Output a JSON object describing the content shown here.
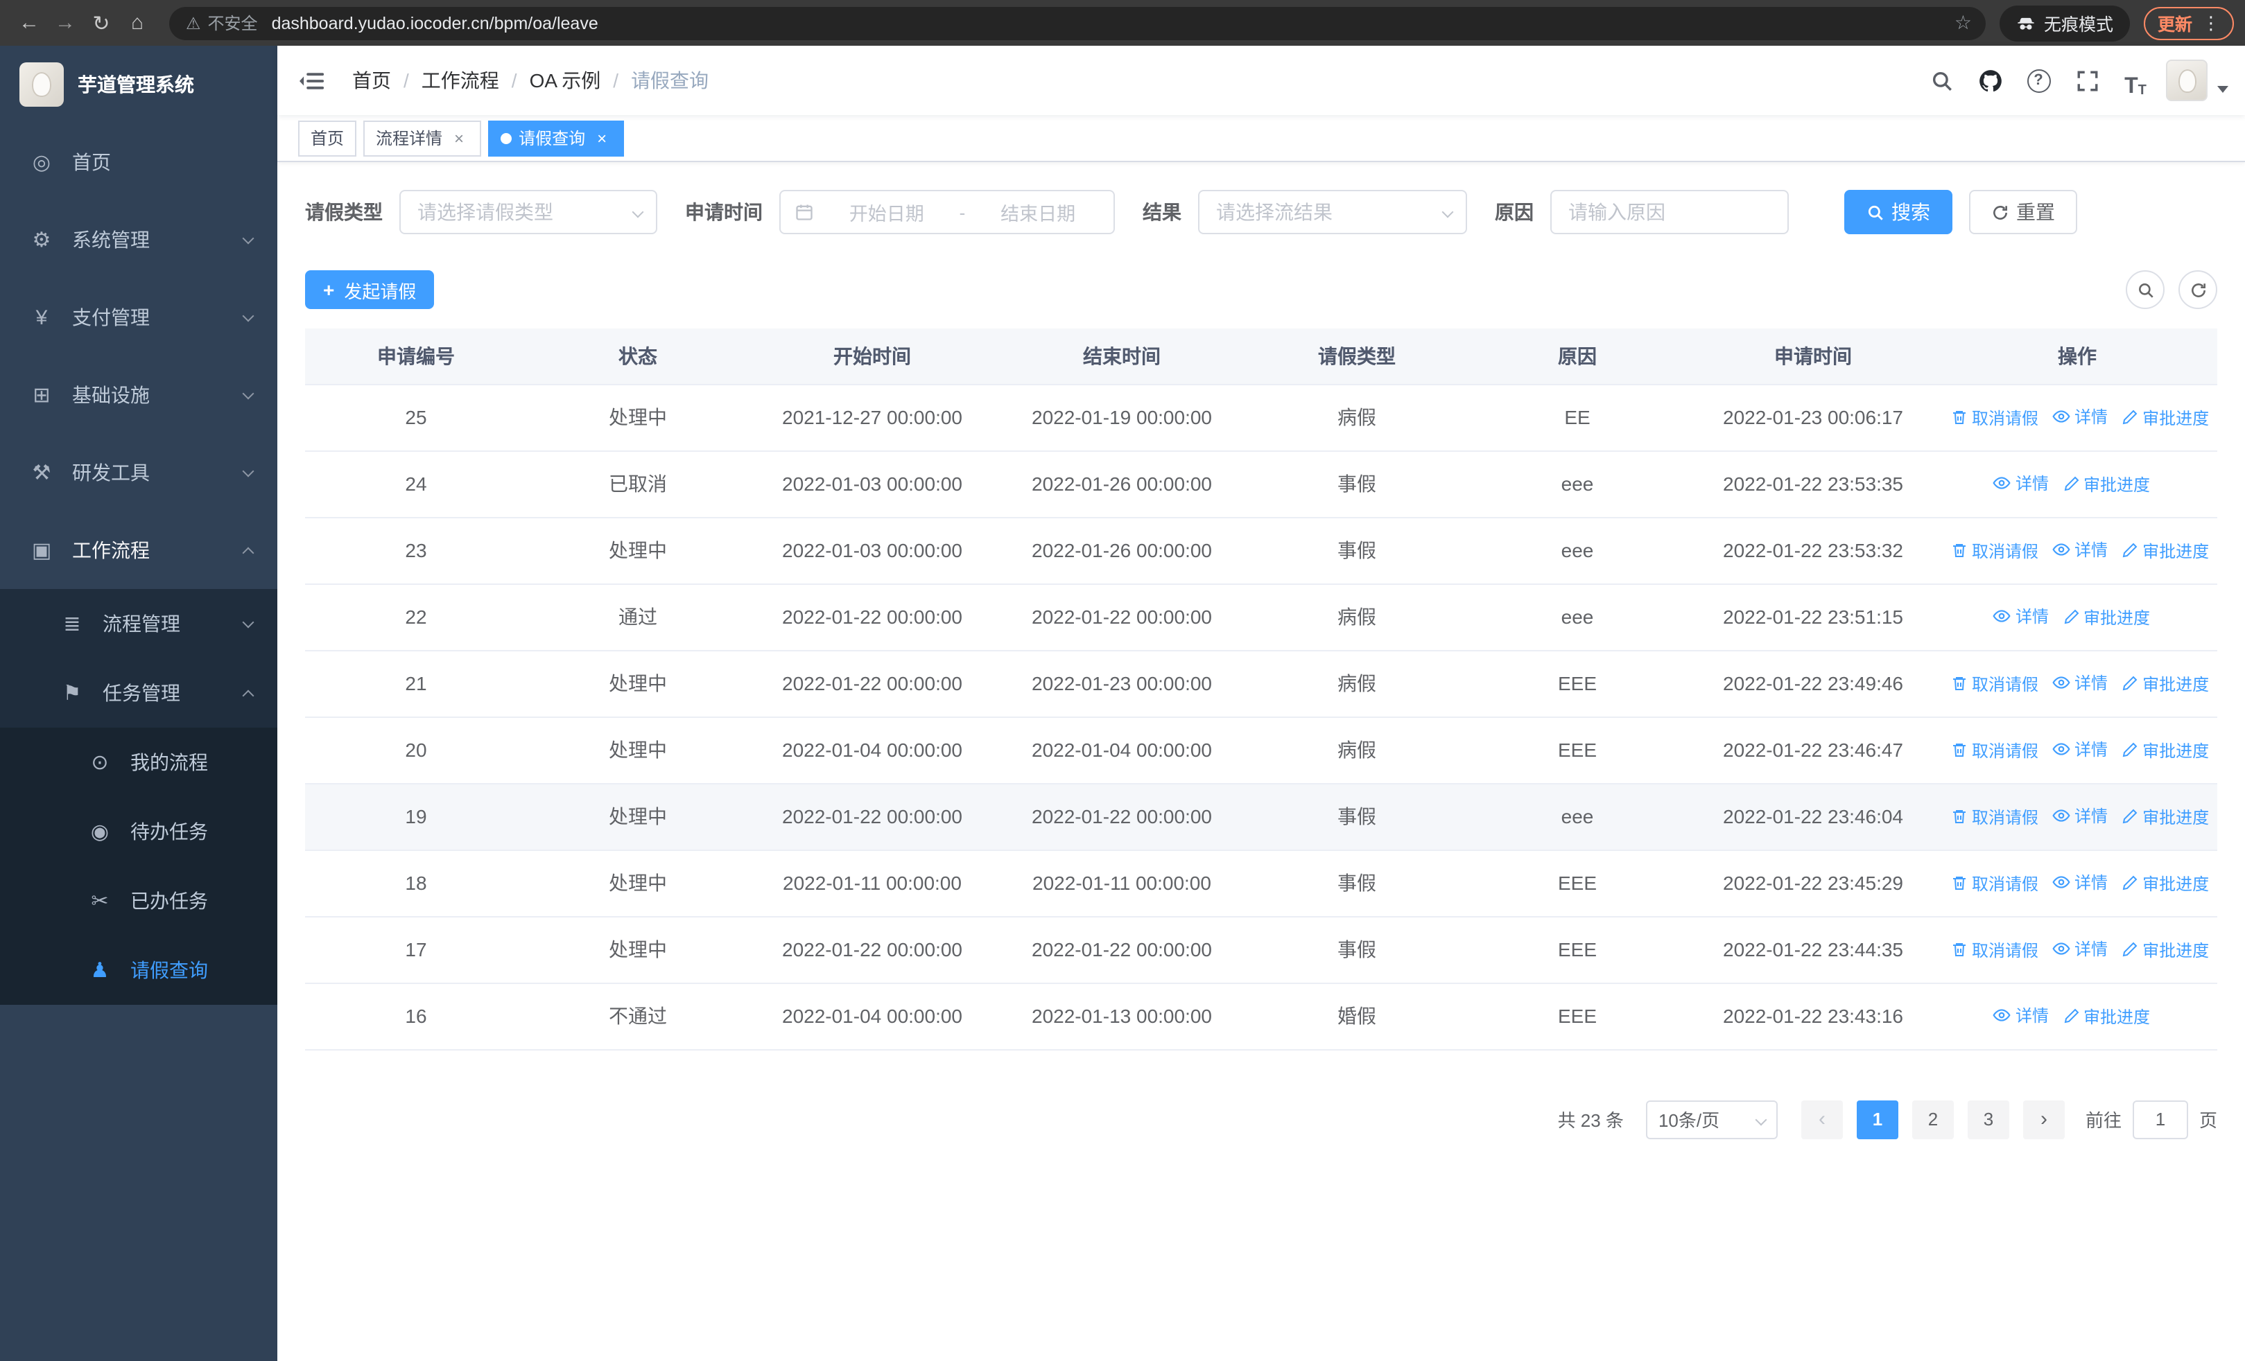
{
  "browser": {
    "security_label": "不安全",
    "url": "dashboard.yudao.iocoder.cn/bpm/oa/leave",
    "incognito_label": "无痕模式",
    "update_label": "更新"
  },
  "icons": {
    "back": "←",
    "forward": "→",
    "reload": "↻",
    "home": "⌂",
    "warning": "⚠",
    "star": "☆",
    "kebab": "⋮",
    "plus": "+",
    "question": "?",
    "tsize_big": "T",
    "tsize_small": "T"
  },
  "sidebar": {
    "logo_title": "芋道管理系统",
    "items": [
      {
        "label": "首页",
        "icon": "◎"
      },
      {
        "label": "系统管理",
        "icon": "⚙"
      },
      {
        "label": "支付管理",
        "icon": "¥"
      },
      {
        "label": "基础设施",
        "icon": "⊞"
      },
      {
        "label": "研发工具",
        "icon": "⚒"
      },
      {
        "label": "工作流程",
        "icon": "▣"
      }
    ],
    "sub_items": [
      {
        "label": "流程管理",
        "icon": "≣"
      },
      {
        "label": "任务管理",
        "icon": "⚑"
      }
    ],
    "leaf_items": [
      {
        "label": "我的流程",
        "icon": "⊙"
      },
      {
        "label": "待办任务",
        "icon": "◉"
      },
      {
        "label": "已办任务",
        "icon": "✂"
      },
      {
        "label": "请假查询",
        "icon": "♟"
      }
    ]
  },
  "header": {
    "breadcrumb": [
      "首页",
      "工作流程",
      "OA 示例",
      "请假查询"
    ],
    "separator": "/"
  },
  "tabs": {
    "close_glyph": "×",
    "items": [
      {
        "label": "首页"
      },
      {
        "label": "流程详情"
      },
      {
        "label": "请假查询"
      }
    ]
  },
  "filters": {
    "leave_type_label": "请假类型",
    "leave_type_placeholder": "请选择请假类型",
    "apply_time_label": "申请时间",
    "start_date_placeholder": "开始日期",
    "range_separator": "-",
    "end_date_placeholder": "结束日期",
    "result_label": "结果",
    "result_placeholder": "请选择流结果",
    "reason_label": "原因",
    "reason_placeholder": "请输入原因",
    "search_label": "搜索",
    "reset_label": "重置"
  },
  "toolbar": {
    "create_label": "发起请假"
  },
  "table": {
    "columns": [
      "申请编号",
      "状态",
      "开始时间",
      "结束时间",
      "请假类型",
      "原因",
      "申请时间",
      "操作"
    ],
    "column_keys": [
      "id",
      "status",
      "start",
      "end",
      "type",
      "reason",
      "applied"
    ],
    "action_labels": {
      "cancel": "取消请假",
      "detail": "详情",
      "progress": "审批进度"
    },
    "rows": [
      {
        "id": "25",
        "status": "处理中",
        "start": "2021-12-27 00:00:00",
        "end": "2022-01-19 00:00:00",
        "type": "病假",
        "reason": "EE",
        "applied": "2022-01-23 00:06:17",
        "cancelable": true,
        "highlighted": false
      },
      {
        "id": "24",
        "status": "已取消",
        "start": "2022-01-03 00:00:00",
        "end": "2022-01-26 00:00:00",
        "type": "事假",
        "reason": "eee",
        "applied": "2022-01-22 23:53:35",
        "cancelable": false,
        "highlighted": false
      },
      {
        "id": "23",
        "status": "处理中",
        "start": "2022-01-03 00:00:00",
        "end": "2022-01-26 00:00:00",
        "type": "事假",
        "reason": "eee",
        "applied": "2022-01-22 23:53:32",
        "cancelable": true,
        "highlighted": false
      },
      {
        "id": "22",
        "status": "通过",
        "start": "2022-01-22 00:00:00",
        "end": "2022-01-22 00:00:00",
        "type": "病假",
        "reason": "eee",
        "applied": "2022-01-22 23:51:15",
        "cancelable": false,
        "highlighted": false
      },
      {
        "id": "21",
        "status": "处理中",
        "start": "2022-01-22 00:00:00",
        "end": "2022-01-23 00:00:00",
        "type": "病假",
        "reason": "EEE",
        "applied": "2022-01-22 23:49:46",
        "cancelable": true,
        "highlighted": false
      },
      {
        "id": "20",
        "status": "处理中",
        "start": "2022-01-04 00:00:00",
        "end": "2022-01-04 00:00:00",
        "type": "病假",
        "reason": "EEE",
        "applied": "2022-01-22 23:46:47",
        "cancelable": true,
        "highlighted": false
      },
      {
        "id": "19",
        "status": "处理中",
        "start": "2022-01-22 00:00:00",
        "end": "2022-01-22 00:00:00",
        "type": "事假",
        "reason": "eee",
        "applied": "2022-01-22 23:46:04",
        "cancelable": true,
        "highlighted": true
      },
      {
        "id": "18",
        "status": "处理中",
        "start": "2022-01-11 00:00:00",
        "end": "2022-01-11 00:00:00",
        "type": "事假",
        "reason": "EEE",
        "applied": "2022-01-22 23:45:29",
        "cancelable": true,
        "highlighted": false
      },
      {
        "id": "17",
        "status": "处理中",
        "start": "2022-01-22 00:00:00",
        "end": "2022-01-22 00:00:00",
        "type": "事假",
        "reason": "EEE",
        "applied": "2022-01-22 23:44:35",
        "cancelable": true,
        "highlighted": false
      },
      {
        "id": "16",
        "status": "不通过",
        "start": "2022-01-04 00:00:00",
        "end": "2022-01-13 00:00:00",
        "type": "婚假",
        "reason": "EEE",
        "applied": "2022-01-22 23:43:16",
        "cancelable": false,
        "highlighted": false
      }
    ]
  },
  "pagination": {
    "total_text": "共 23 条",
    "page_size": "10条/页",
    "pages": [
      "1",
      "2",
      "3"
    ],
    "active_page": "1",
    "prev_glyph": "‹",
    "next_glyph": "›",
    "goto_label": "前往",
    "goto_value": "1",
    "goto_suffix": "页"
  }
}
